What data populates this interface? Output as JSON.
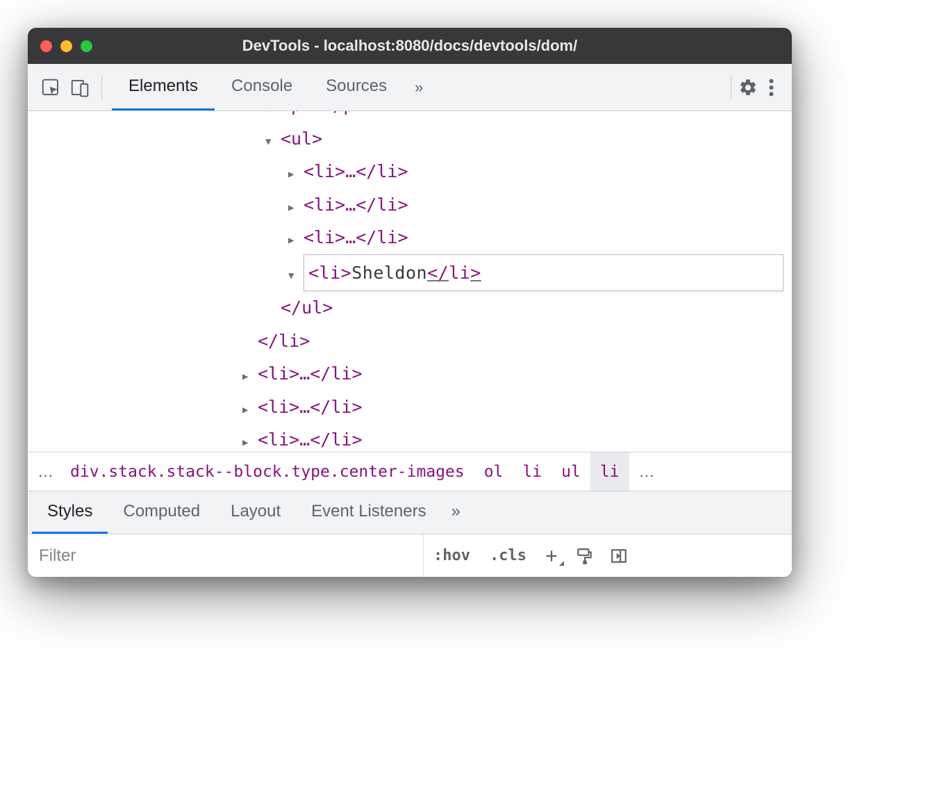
{
  "window": {
    "title": "DevTools - localhost:8080/docs/devtools/dom/"
  },
  "toolbar_tabs": {
    "elements": "Elements",
    "console": "Console",
    "sources": "Sources",
    "more": "»"
  },
  "dom": {
    "p_open": "<p>",
    "p_dots": "…",
    "p_close": "</p>",
    "ul_open": "<ul>",
    "li_collapsed": "<li>…</li>",
    "editing_value": "<li>Sheldon</li>",
    "ul_close": "</ul>",
    "li_close": "</li>"
  },
  "breadcrumb": {
    "more_left": "…",
    "div": "div.stack.stack--block.type.center-images",
    "ol": "ol",
    "li1": "li",
    "ul": "ul",
    "li2": "li",
    "more_right": "…"
  },
  "styles_tabs": {
    "styles": "Styles",
    "computed": "Computed",
    "layout": "Layout",
    "eventlisteners": "Event Listeners",
    "more": "»"
  },
  "filter": {
    "placeholder": "Filter",
    "hov": ":hov",
    "cls": ".cls"
  }
}
